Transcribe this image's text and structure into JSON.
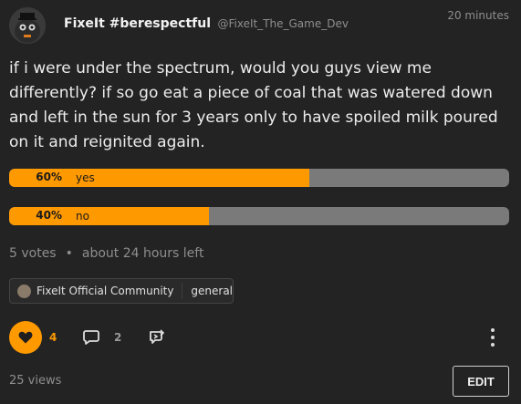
{
  "post": {
    "author_name": "FixeIt #berespectful",
    "author_handle": "@FixeIt_The_Game_Dev",
    "time": "20 minutes",
    "body": "if i were under the spectrum, would you guys view me differently? if so go eat a piece of coal that was watered down and left in the sun for 3 years only to have spoiled milk poured on it and reignited again."
  },
  "poll": {
    "options": [
      {
        "percent_label": "60%",
        "label": "yes",
        "fraction": 0.6
      },
      {
        "percent_label": "40%",
        "label": "no",
        "fraction": 0.4
      }
    ],
    "votes": "5 votes",
    "time_left": "about 24 hours left",
    "separator": "•"
  },
  "community": {
    "name": "FixeIt Official Community",
    "channel": "general"
  },
  "actions": {
    "like_count": "4",
    "comment_count": "2"
  },
  "footer": {
    "views": "25 views",
    "edit_label": "EDIT"
  },
  "colors": {
    "accent": "#ff9900",
    "background": "#232323",
    "bar_track": "#7a7a7a"
  },
  "icons": [
    "avatar-mascot",
    "heart-icon",
    "comment-icon",
    "share-icon",
    "more-vertical-icon"
  ]
}
